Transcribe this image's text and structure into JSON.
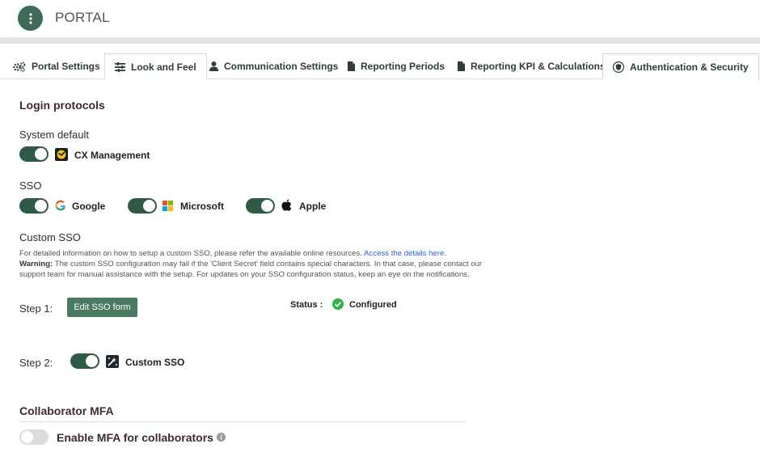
{
  "header": {
    "title": "PORTAL"
  },
  "tabs": [
    {
      "label": "Portal Settings",
      "icon": "gears-icon"
    },
    {
      "label": "Look and Feel",
      "icon": "sliders-icon"
    },
    {
      "label": "Communication Settings",
      "icon": "user-icon"
    },
    {
      "label": "Reporting Periods",
      "icon": "file-icon"
    },
    {
      "label": "Reporting KPI & Calculations",
      "icon": "file-icon"
    },
    {
      "label": "Authentication & Security",
      "icon": "shield-icon",
      "active": true
    }
  ],
  "login": {
    "title": "Login protocols",
    "system_default": {
      "title": "System default",
      "label": "CX Management",
      "enabled": true
    },
    "sso": {
      "title": "SSO",
      "providers": [
        {
          "label": "Google",
          "enabled": true
        },
        {
          "label": "Microsoft",
          "enabled": true
        },
        {
          "label": "Apple",
          "enabled": true
        }
      ]
    },
    "custom_sso": {
      "title": "Custom SSO",
      "info_text": "For detailed information on how to setup a custom SSO, please refer the available online resources.",
      "info_link": "Access the details here.",
      "warning_label": "Warning:",
      "warning_text": "The custom SSO configuration may fail if the 'Client Secret' field contains special characters. In that case, please contact our support team for manual assistance with the setup. For updates on your SSO configuration status, keep an eye on the notifications.",
      "step1_label": "Step 1:",
      "edit_button": "Edit SSO form",
      "status_label": "Status :",
      "status_value": "Configured",
      "step2_label": "Step 2:",
      "custom_label": "Custom SSO",
      "custom_enabled": true
    }
  },
  "mfa": {
    "title": "Collaborator MFA",
    "label": "Enable MFA for collaborators",
    "enabled": false
  },
  "colors": {
    "accent": "#2f5a45",
    "button": "#4a7a63",
    "link": "#2766d4",
    "success": "#2fb545"
  }
}
